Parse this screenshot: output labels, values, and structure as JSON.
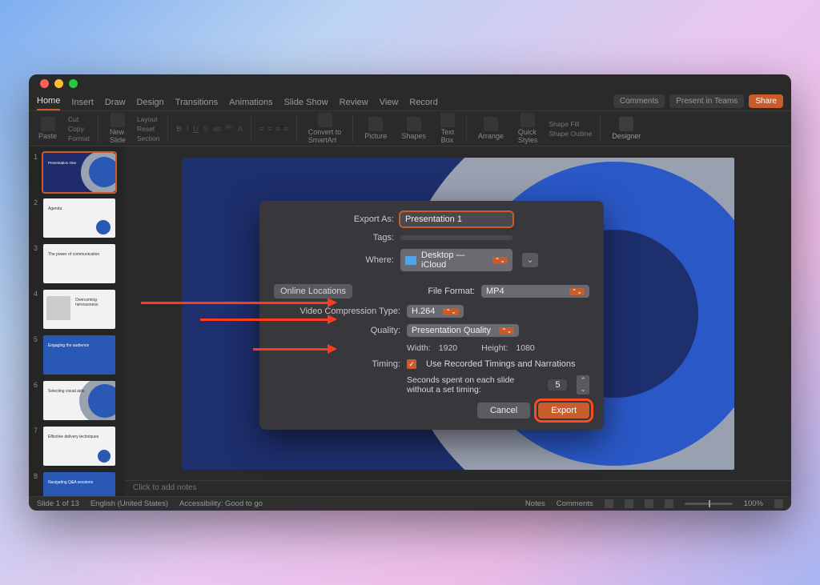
{
  "tabs": [
    "Home",
    "Insert",
    "Draw",
    "Design",
    "Transitions",
    "Animations",
    "Slide Show",
    "Review",
    "View",
    "Record"
  ],
  "right_actions": {
    "comments": "Comments",
    "present": "Present in Teams",
    "share": "Share"
  },
  "ribbon": {
    "paste": "Paste",
    "cut": "Cut",
    "copy": "Copy",
    "format": "Format",
    "new_slide": "New\nSlide",
    "layout": "Layout",
    "reset": "Reset",
    "section": "Section",
    "convert": "Convert to\nSmartArt",
    "picture": "Picture",
    "shapes": "Shapes",
    "textbox": "Text\nBox",
    "arrange": "Arrange",
    "quick": "Quick\nStyles",
    "shapefill": "Shape Fill",
    "shapeoutline": "Shape Outline",
    "designer": "Designer"
  },
  "thumbs": [
    {
      "n": "1",
      "title": "Presentation One"
    },
    {
      "n": "2",
      "title": "Agenda"
    },
    {
      "n": "3",
      "title": "The power of communication"
    },
    {
      "n": "4",
      "title": "Overcoming nervousness"
    },
    {
      "n": "5",
      "title": "Engaging the audience"
    },
    {
      "n": "6",
      "title": "Selecting visual aids"
    },
    {
      "n": "7",
      "title": "Effective delivery techniques"
    },
    {
      "n": "8",
      "title": "Navigating Q&A sessions"
    }
  ],
  "notes_placeholder": "Click to add notes",
  "statusbar": {
    "slide": "Slide 1 of 13",
    "lang": "English (United States)",
    "access": "Accessibility: Good to go",
    "notes": "Notes",
    "comments": "Comments",
    "zoom": "100%"
  },
  "dialog": {
    "export_as_label": "Export As:",
    "export_as_value": "Presentation 1",
    "tags_label": "Tags:",
    "where_label": "Where:",
    "where_value": "Desktop — iCloud",
    "online": "Online Locations",
    "file_format_label": "File Format:",
    "file_format_value": "MP4",
    "video_comp_label": "Video Compression Type:",
    "video_comp_value": "H.264",
    "quality_label": "Quality:",
    "quality_value": "Presentation Quality",
    "width_label": "Width:",
    "width_value": "1920",
    "height_label": "Height:",
    "height_value": "1080",
    "timing_label": "Timing:",
    "timing_checkbox": "Use Recorded Timings and Narrations",
    "seconds_label": "Seconds spent on each slide without a set timing:",
    "seconds_value": "5",
    "cancel": "Cancel",
    "export": "Export"
  }
}
